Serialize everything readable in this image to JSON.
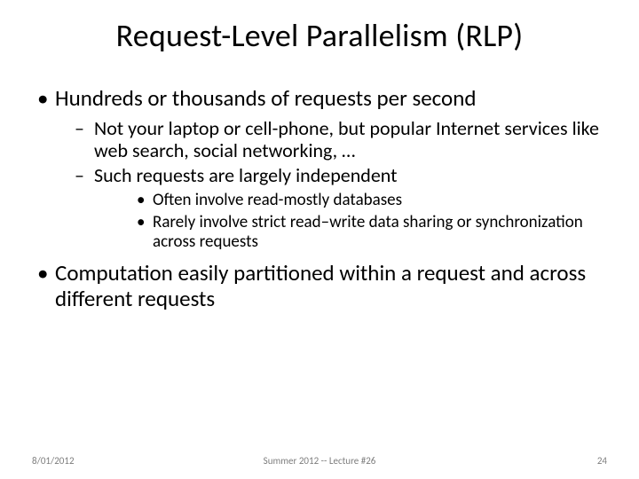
{
  "title": "Request-Level Parallelism (RLP)",
  "bullets": {
    "b1": "Hundreds or thousands of requests per second",
    "b1_1": "Not your laptop or cell-phone, but popular Internet services like web search, social networking, …",
    "b1_2": "Such requests are largely independent",
    "b1_2_1": "Often involve read-mostly databases",
    "b1_2_2": "Rarely involve strict read–write data sharing or synchronization across requests",
    "b2": "Computation easily partitioned within a request and across different requests"
  },
  "footer": {
    "date": "8/01/2012",
    "center": "Summer 2012 -- Lecture #26",
    "page": "24"
  }
}
